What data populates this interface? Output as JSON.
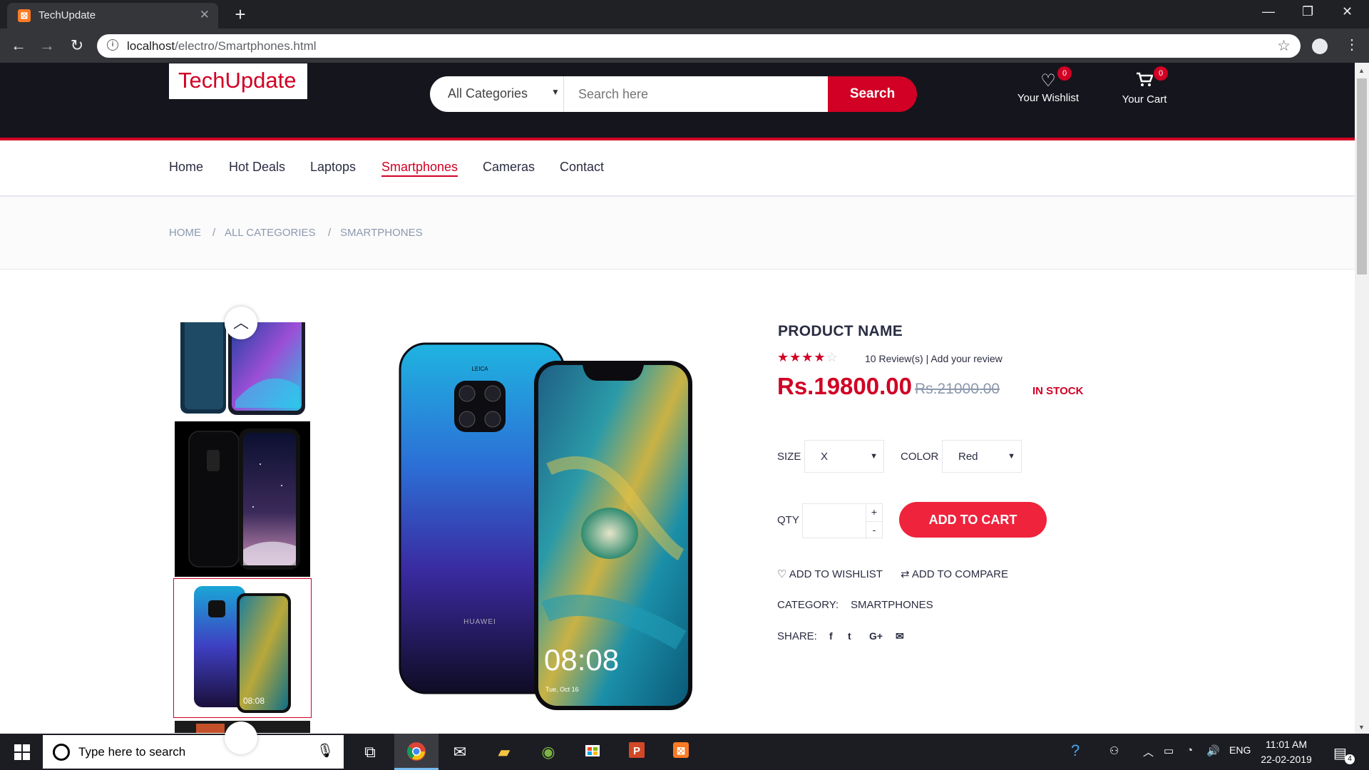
{
  "browser": {
    "tab_title": "TechUpdate",
    "tab_favicon": "xampp-icon",
    "url_host": "localhost",
    "url_path": "/electro/Smartphones.html"
  },
  "header": {
    "logo": "TechUpdate",
    "category_select": "All Categories",
    "search_placeholder": "Search here",
    "search_button": "Search",
    "wishlist_label": "Your Wishlist",
    "wishlist_count": "0",
    "cart_label": "Your Cart",
    "cart_count": "0"
  },
  "nav": {
    "items": [
      "Home",
      "Hot Deals",
      "Laptops",
      "Smartphones",
      "Cameras",
      "Contact"
    ],
    "active": "Smartphones"
  },
  "breadcrumb": [
    "HOME",
    "ALL CATEGORIES",
    "SMARTPHONES"
  ],
  "breadcrumb_sep": "/",
  "product": {
    "name": "PRODUCT NAME",
    "rating": 4,
    "rating_max": 5,
    "reviews": "10 Review(s) | Add your review",
    "price": "Rs.19800.00",
    "old_price": "Rs.21000.00",
    "stock": "IN STOCK",
    "size_label": "SIZE",
    "size_value": "X",
    "color_label": "COLOR",
    "color_value": "Red",
    "qty_label": "QTY",
    "qty_plus": "+",
    "qty_minus": "-",
    "add_to_cart": "ADD TO CART",
    "add_to_wishlist": "ADD TO WISHLIST",
    "add_to_compare": "ADD TO COMPARE",
    "category_label": "CATEGORY:",
    "category_value": "SMARTPHONES",
    "share_label": "SHARE:",
    "share_icons": [
      "f",
      "t",
      "G+",
      "✉"
    ],
    "main_image": {
      "brand_text": "HUAWEI",
      "camera_text": "LEICA",
      "clock": "08:08",
      "date": "Tue, Oct 16"
    }
  },
  "taskbar": {
    "search_placeholder": "Type here to search",
    "lang": "ENG",
    "time": "11:01 AM",
    "date": "22-02-2019",
    "notifications": "4"
  },
  "colors": {
    "accent": "#d10024",
    "header_bg": "#15161d",
    "button_red": "#ef233c"
  }
}
